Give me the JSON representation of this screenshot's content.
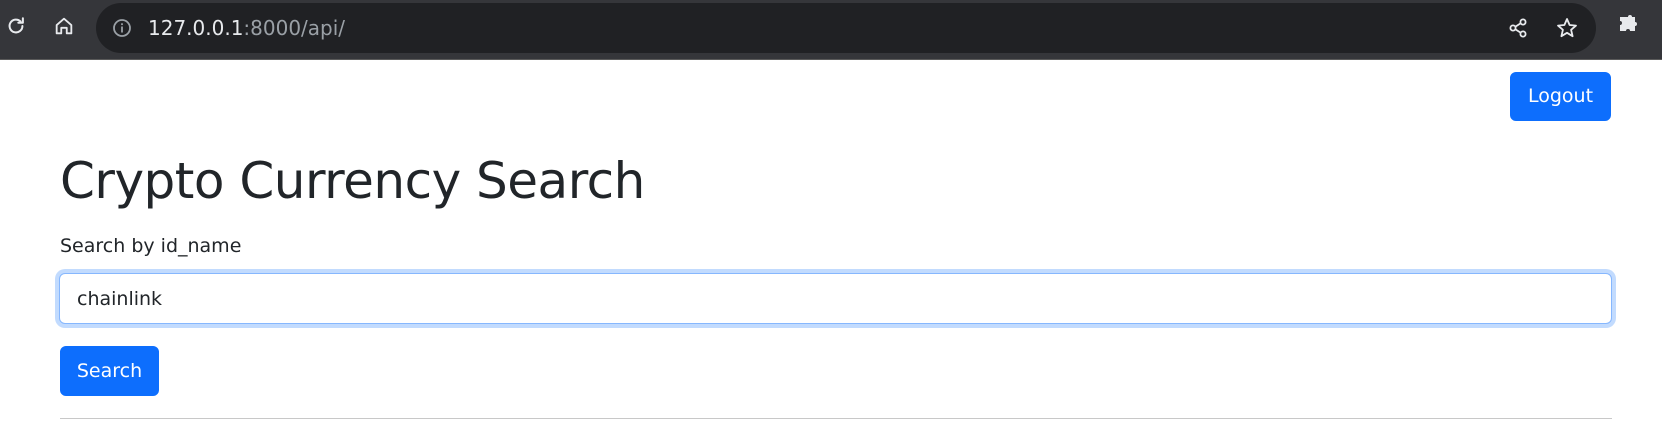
{
  "browser": {
    "url_host": "127.0.0.1",
    "url_rest": ":8000/api/",
    "icons": [
      "reload-icon",
      "home-icon",
      "info-icon",
      "share-icon",
      "star-icon",
      "extensions-icon"
    ]
  },
  "header": {
    "logout_label": "Logout"
  },
  "main": {
    "title": "Crypto Currency Search",
    "search_label": "Search by id_name",
    "search_value": "chainlink",
    "search_button_label": "Search"
  },
  "colors": {
    "primary": "#0d6efd",
    "chrome_bg": "#35363a",
    "omnibox_bg": "#202124"
  }
}
